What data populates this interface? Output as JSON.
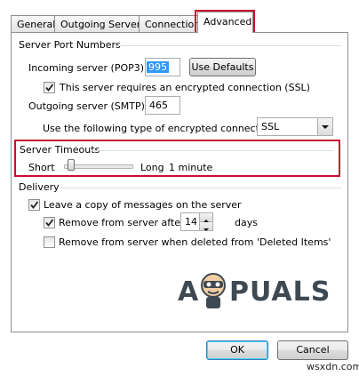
{
  "tabs": [
    {
      "label": "General"
    },
    {
      "label": "Outgoing Server"
    },
    {
      "label": "Connection"
    },
    {
      "label": "Advanced"
    }
  ],
  "server_ports": {
    "group_label": "Server Port Numbers",
    "incoming_label": "Incoming server (POP3):",
    "incoming_value": "995",
    "use_defaults_label": "Use Defaults",
    "ssl_checkbox_label": "This server requires an encrypted connection (SSL)",
    "outgoing_label": "Outgoing server (SMTP):",
    "outgoing_value": "465",
    "encryption_label": "Use the following type of encrypted connection:",
    "encryption_value": "SSL"
  },
  "timeouts": {
    "group_label": "Server Timeouts",
    "short_label": "Short",
    "long_label": "Long",
    "value_label": "1 minute",
    "slider_level": 0.05
  },
  "delivery": {
    "group_label": "Delivery",
    "leave_copy_label": "Leave a copy of messages on the server",
    "remove_after_label": "Remove from server after",
    "remove_after_value": "14",
    "days_label": "days",
    "remove_deleted_label": "Remove from server when deleted from 'Deleted Items'"
  },
  "footer": {
    "ok_label": "OK",
    "cancel_label": "Cancel"
  },
  "watermark": {
    "text_a": "A",
    "text_rest": "PUALS",
    "site": "wsxdn.com"
  },
  "colors": {
    "highlight_red": "#c8102e",
    "selection_blue": "#3399ff"
  }
}
